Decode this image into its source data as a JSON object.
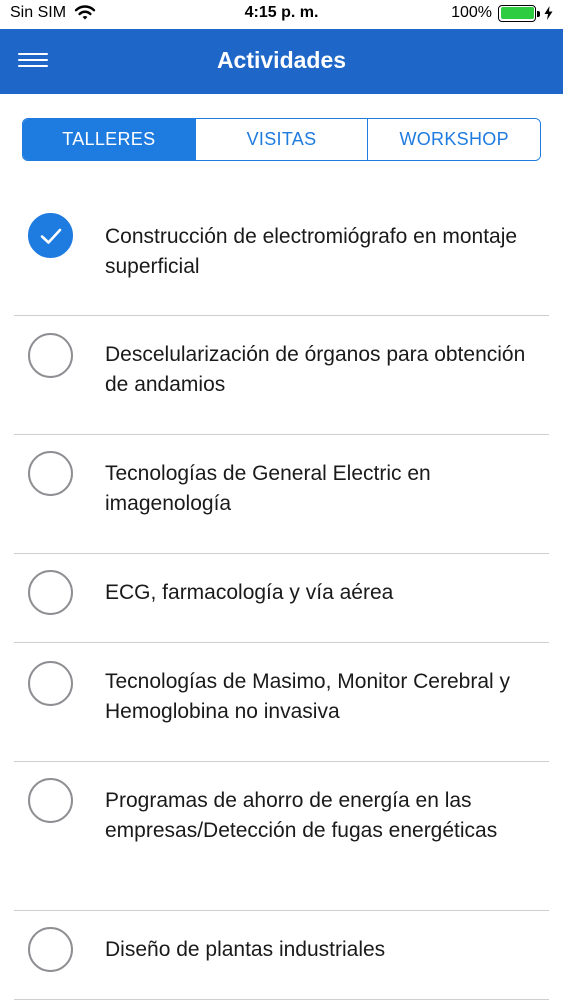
{
  "status_bar": {
    "carrier": "Sin SIM",
    "time": "4:15 p. m.",
    "battery": "100%",
    "battery_level": 1.0
  },
  "nav": {
    "title": "Actividades",
    "menu_icon": "hamburger-menu-icon"
  },
  "tabs": [
    {
      "label": "TALLERES",
      "active": true
    },
    {
      "label": "VISITAS",
      "active": false
    },
    {
      "label": "WORKSHOP",
      "active": false
    }
  ],
  "activities": [
    {
      "title": "Construcción de electromiógrafo en montaje superficial",
      "checked": true
    },
    {
      "title": "Descelularización de órganos para obtención de andamios",
      "checked": false
    },
    {
      "title": "Tecnologías de General Electric en imagenología",
      "checked": false
    },
    {
      "title": "ECG, farmacología y vía aérea",
      "checked": false
    },
    {
      "title": "Tecnologías de Masimo, Monitor Cerebral y Hemoglobina no invasiva",
      "checked": false
    },
    {
      "title": "Programas de ahorro de energía en las empresas/Detección de fugas energéticas",
      "checked": false
    },
    {
      "title": "Diseño de plantas industriales",
      "checked": false
    }
  ],
  "colors": {
    "nav_bg": "#1e66c8",
    "accent": "#1e7be0",
    "battery": "#2ecc40"
  }
}
